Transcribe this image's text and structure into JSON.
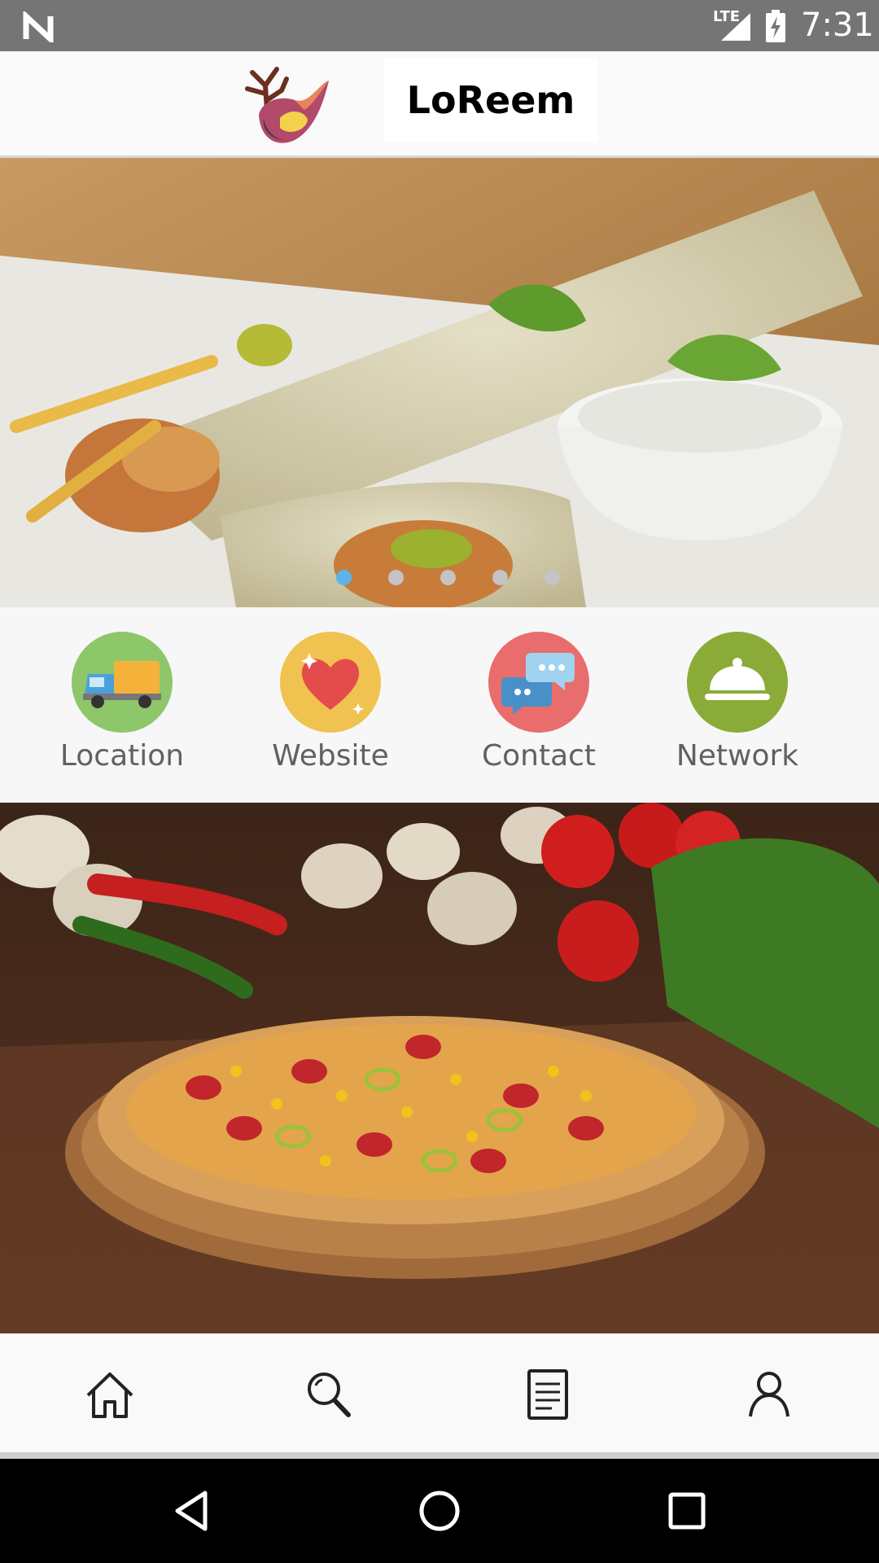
{
  "status_bar": {
    "network_type": "LTE",
    "time": "7:31"
  },
  "app_bar": {
    "brand_name": "LoReem"
  },
  "banner": {
    "slide_count": 5,
    "active_slide": 1
  },
  "shortcuts": [
    {
      "label": "Location",
      "icon": "delivery-truck-icon",
      "color": "#8dc76a"
    },
    {
      "label": "Website",
      "icon": "heart-icon",
      "color": "#f0c24f"
    },
    {
      "label": "Contact",
      "icon": "chat-bubbles-icon",
      "color": "#e96d6d"
    },
    {
      "label": "Network",
      "icon": "food-cloche-icon",
      "color": "#8aab37"
    }
  ],
  "bottom_nav": [
    {
      "icon": "home-icon"
    },
    {
      "icon": "search-icon"
    },
    {
      "icon": "document-icon"
    },
    {
      "icon": "profile-icon"
    }
  ],
  "system_nav": [
    {
      "icon": "back-icon"
    },
    {
      "icon": "home-circle-icon"
    },
    {
      "icon": "recents-icon"
    }
  ]
}
